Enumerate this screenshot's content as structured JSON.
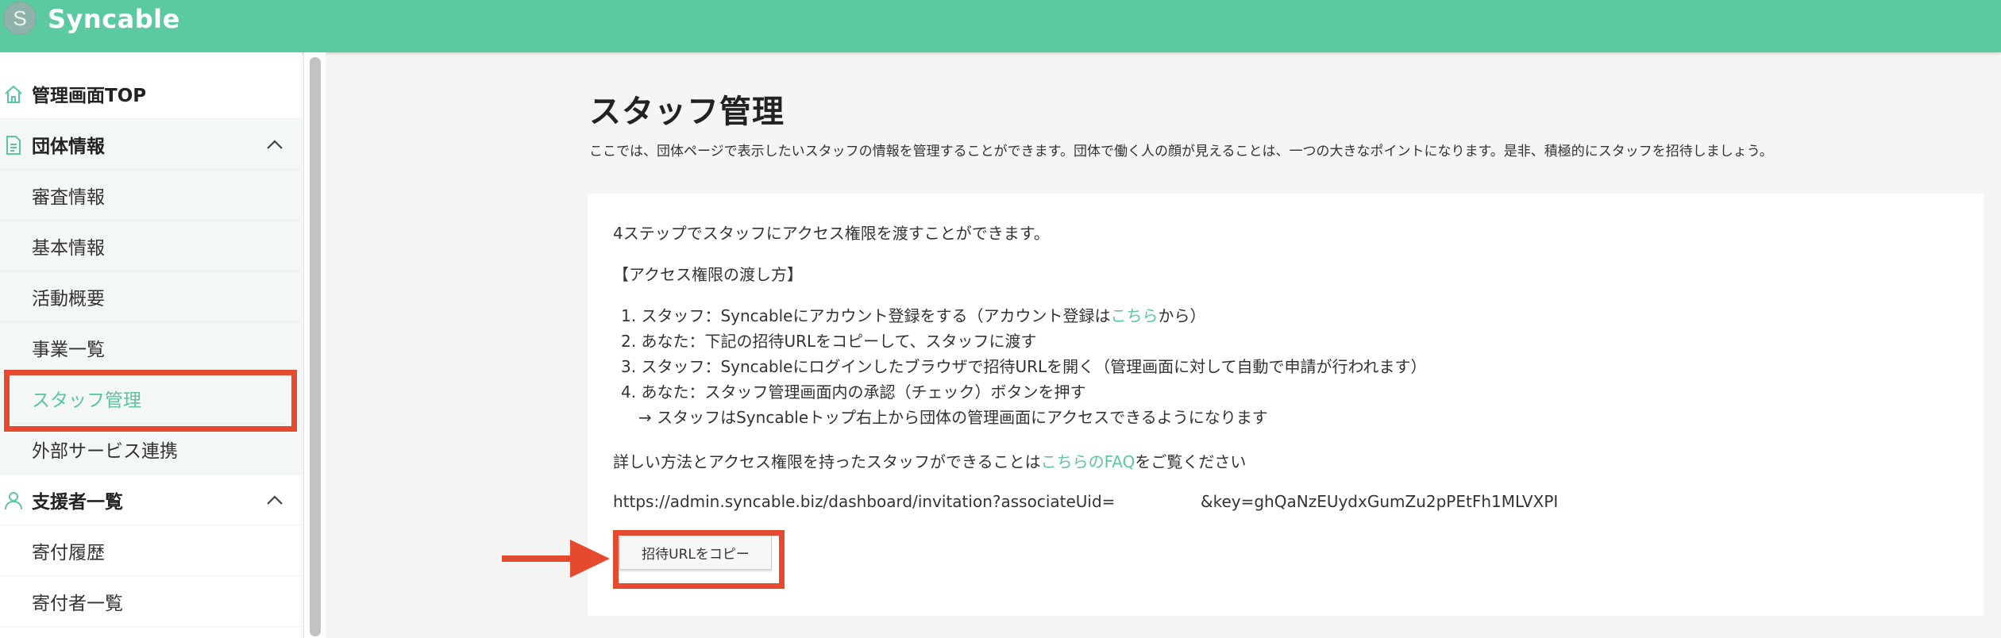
{
  "app": {
    "name": "Syncable",
    "logo_letter": "S",
    "brand_color": "#5ccaa0",
    "highlight_color": "#e64a2e"
  },
  "sidebar": {
    "top_item": {
      "label": "管理画面TOP",
      "icon": "home-icon"
    },
    "groups": [
      {
        "label": "団体情報",
        "icon": "document-icon",
        "expanded": true,
        "items": [
          {
            "label": "審査情報"
          },
          {
            "label": "基本情報"
          },
          {
            "label": "活動概要"
          },
          {
            "label": "事業一覧"
          },
          {
            "label": "スタッフ管理",
            "active": true
          },
          {
            "label": "外部サービス連携"
          }
        ]
      },
      {
        "label": "支援者一覧",
        "icon": "person-icon",
        "expanded": true,
        "items": [
          {
            "label": "寄付履歴"
          },
          {
            "label": "寄付者一覧"
          }
        ]
      }
    ]
  },
  "main": {
    "title": "スタッフ管理",
    "description": "ここでは、団体ページで表示したいスタッフの情報を管理することができます。団体で働く人の顔が見えることは、一つの大きなポイントになります。是非、積極的にスタッフを招待しましょう。",
    "card": {
      "intro": "4ステップでスタッフにアクセス権限を渡すことができます。",
      "section_heading": "【アクセス権限の渡し方】",
      "step1_prefix": "1. スタッフ：Syncableにアカウント登録をする（アカウント登録は",
      "step1_link": "こちら",
      "step1_suffix": "から）",
      "step2": "2. あなた：下記の招待URLをコピーして、スタッフに渡す",
      "step3": "3. スタッフ：Syncableにログインしたブラウザで招待URLを開く（管理画面に対して自動で申請が行われます）",
      "step4": "4. あなた：スタッフ管理画面内の承認（チェック）ボタンを押す",
      "step4_note": "→ スタッフはSyncableトップ右上から団体の管理画面にアクセスできるようになります",
      "faq_prefix": "詳しい方法とアクセス権限を持ったスタッフができることは",
      "faq_link": "こちらのFAQ",
      "faq_suffix": "をご覧ください",
      "invite_url_part1": "https://admin.syncable.biz/dashboard/invitation?associateUid=",
      "invite_url_part2": "&key=ghQaNzEUydxGumZu2pPEtFh1MLVXPI",
      "copy_button_label": "招待URLをコピー"
    }
  }
}
